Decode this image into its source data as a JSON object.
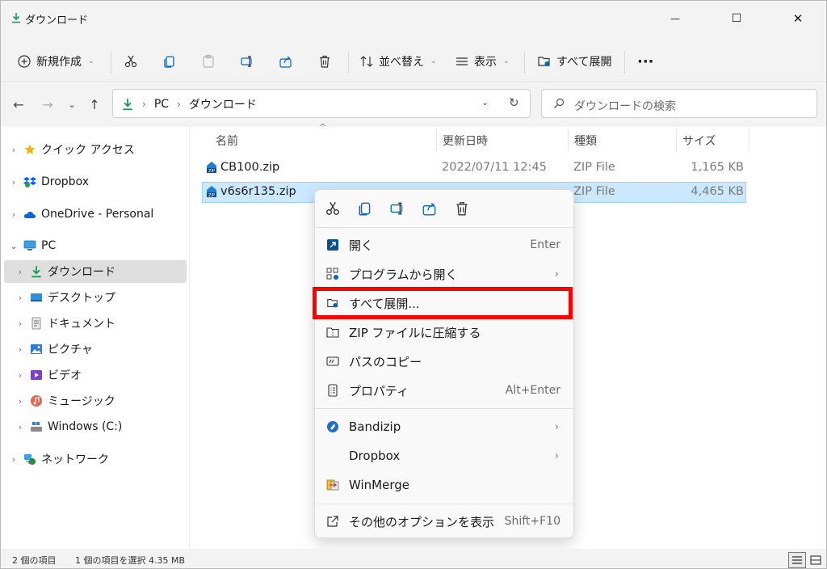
{
  "window": {
    "title": "ダウンロード",
    "minimize": "—",
    "maximize": "☐",
    "close": "✕"
  },
  "toolbar": {
    "new": "新規作成",
    "sort": "並べ替え",
    "view": "表示",
    "extract_all": "すべて展開",
    "more": "···"
  },
  "address": {
    "crumbs": [
      "PC",
      "ダウンロード"
    ],
    "search_placeholder": "ダウンロードの検索"
  },
  "nav": {
    "items": [
      {
        "label": "クイック アクセス"
      },
      {
        "label": "Dropbox"
      },
      {
        "label": "OneDrive - Personal"
      },
      {
        "label": "PC"
      },
      {
        "label": "ダウンロード"
      },
      {
        "label": "デスクトップ"
      },
      {
        "label": "ドキュメント"
      },
      {
        "label": "ピクチャ"
      },
      {
        "label": "ビデオ"
      },
      {
        "label": "ミュージック"
      },
      {
        "label": "Windows (C:)"
      },
      {
        "label": "ネットワーク"
      }
    ]
  },
  "columns": {
    "name": "名前",
    "modified": "更新日時",
    "type": "種類",
    "size": "サイズ"
  },
  "files": [
    {
      "name": "CB100.zip",
      "modified": "2022/07/11 12:45",
      "type": "ZIP File",
      "size": "1,165 KB"
    },
    {
      "name": "v6s6r135.zip",
      "type": "ZIP File",
      "size": "4,465 KB"
    }
  ],
  "context_menu": {
    "items": [
      {
        "label": "開く",
        "key": "Enter"
      },
      {
        "label": "プログラムから開く"
      },
      {
        "label": "すべて展開..."
      },
      {
        "label": "ZIP ファイルに圧縮する"
      },
      {
        "label": "パスのコピー"
      },
      {
        "label": "プロパティ",
        "key": "Alt+Enter"
      },
      {
        "label": "Bandizip"
      },
      {
        "label": "Dropbox"
      },
      {
        "label": "WinMerge"
      },
      {
        "label": "その他のオプションを表示",
        "key": "Shift+F10"
      }
    ]
  },
  "status": {
    "item_count": "2 個の項目",
    "selection": "1 個の項目を選択  4.35 MB"
  },
  "colors": {
    "accent": "#0067c0",
    "selection": "#cce8ff",
    "highlight_box": "#ff0000",
    "download_green": "#1a9a5a"
  }
}
